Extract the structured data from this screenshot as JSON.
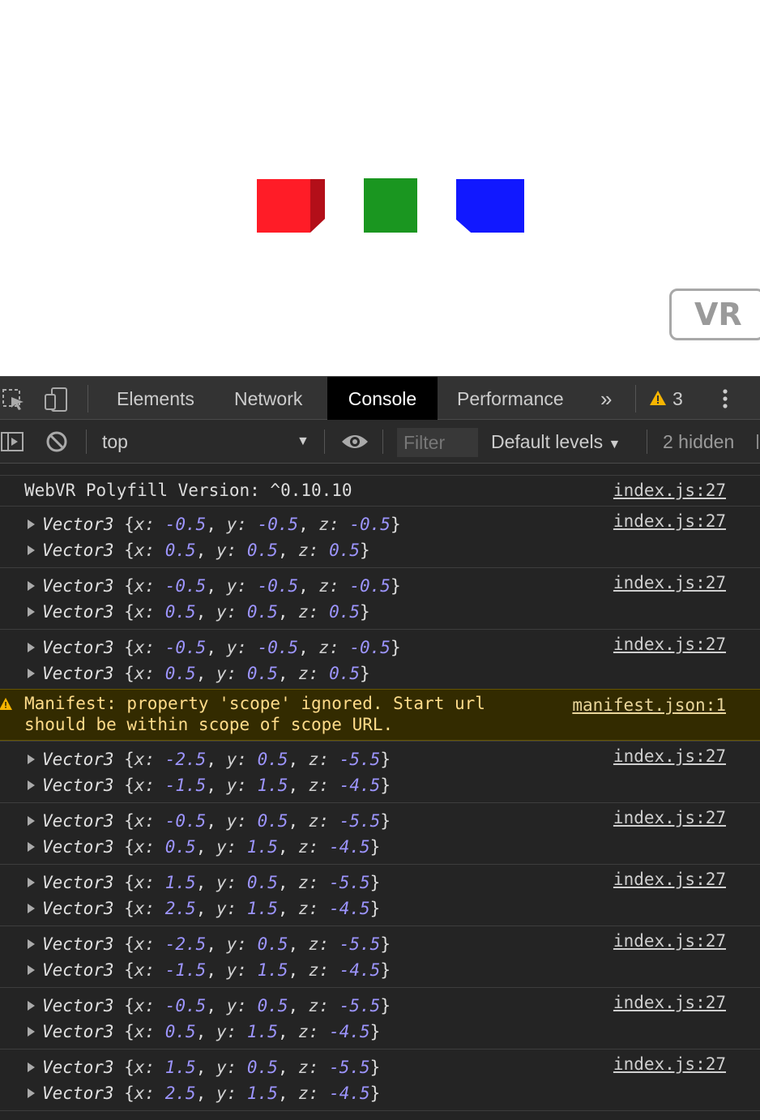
{
  "scene": {
    "cubes": [
      {
        "name": "red-cube",
        "color": "#ff1c27"
      },
      {
        "name": "green-cube",
        "color": "#1a9620"
      },
      {
        "name": "blue-cube",
        "color": "#1118ff"
      }
    ],
    "vr_button": "VR"
  },
  "devtools": {
    "tabs": [
      "Elements",
      "Network",
      "Console",
      "Performance"
    ],
    "active_tab": "Console",
    "more_tabs_icon": "chevron-double-right-icon",
    "warning_count": "3",
    "context": "top",
    "filter_placeholder": "Filter",
    "levels": "Default levels",
    "hidden": "2 hidden"
  },
  "console": {
    "polyfill": {
      "text": "WebVR Polyfill Version: ^0.10.10",
      "source": "index.js:27"
    },
    "groups": [
      {
        "source": "index.js:27",
        "a": [
          "-0.5",
          "-0.5",
          "-0.5"
        ],
        "b": [
          "0.5",
          "0.5",
          "0.5"
        ]
      },
      {
        "source": "index.js:27",
        "a": [
          "-0.5",
          "-0.5",
          "-0.5"
        ],
        "b": [
          "0.5",
          "0.5",
          "0.5"
        ]
      },
      {
        "source": "index.js:27",
        "a": [
          "-0.5",
          "-0.5",
          "-0.5"
        ],
        "b": [
          "0.5",
          "0.5",
          "0.5"
        ]
      },
      {
        "source": "index.js:27",
        "a": [
          "-2.5",
          "0.5",
          "-5.5"
        ],
        "b": [
          "-1.5",
          "1.5",
          "-4.5"
        ]
      },
      {
        "source": "index.js:27",
        "a": [
          "-0.5",
          "0.5",
          "-5.5"
        ],
        "b": [
          "0.5",
          "1.5",
          "-4.5"
        ]
      },
      {
        "source": "index.js:27",
        "a": [
          "1.5",
          "0.5",
          "-5.5"
        ],
        "b": [
          "2.5",
          "1.5",
          "-4.5"
        ]
      },
      {
        "source": "index.js:27",
        "a": [
          "-2.5",
          "0.5",
          "-5.5"
        ],
        "b": [
          "-1.5",
          "1.5",
          "-4.5"
        ]
      },
      {
        "source": "index.js:27",
        "a": [
          "-0.5",
          "0.5",
          "-5.5"
        ],
        "b": [
          "0.5",
          "1.5",
          "-4.5"
        ]
      },
      {
        "source": "index.js:27",
        "a": [
          "1.5",
          "0.5",
          "-5.5"
        ],
        "b": [
          "2.5",
          "1.5",
          "-4.5"
        ]
      }
    ],
    "warning": {
      "line1": "Manifest: property 'scope' ignored. Start url",
      "line2": "should be within scope of scope URL.",
      "source": "manifest.json:1"
    },
    "vector_label": "Vector3"
  }
}
